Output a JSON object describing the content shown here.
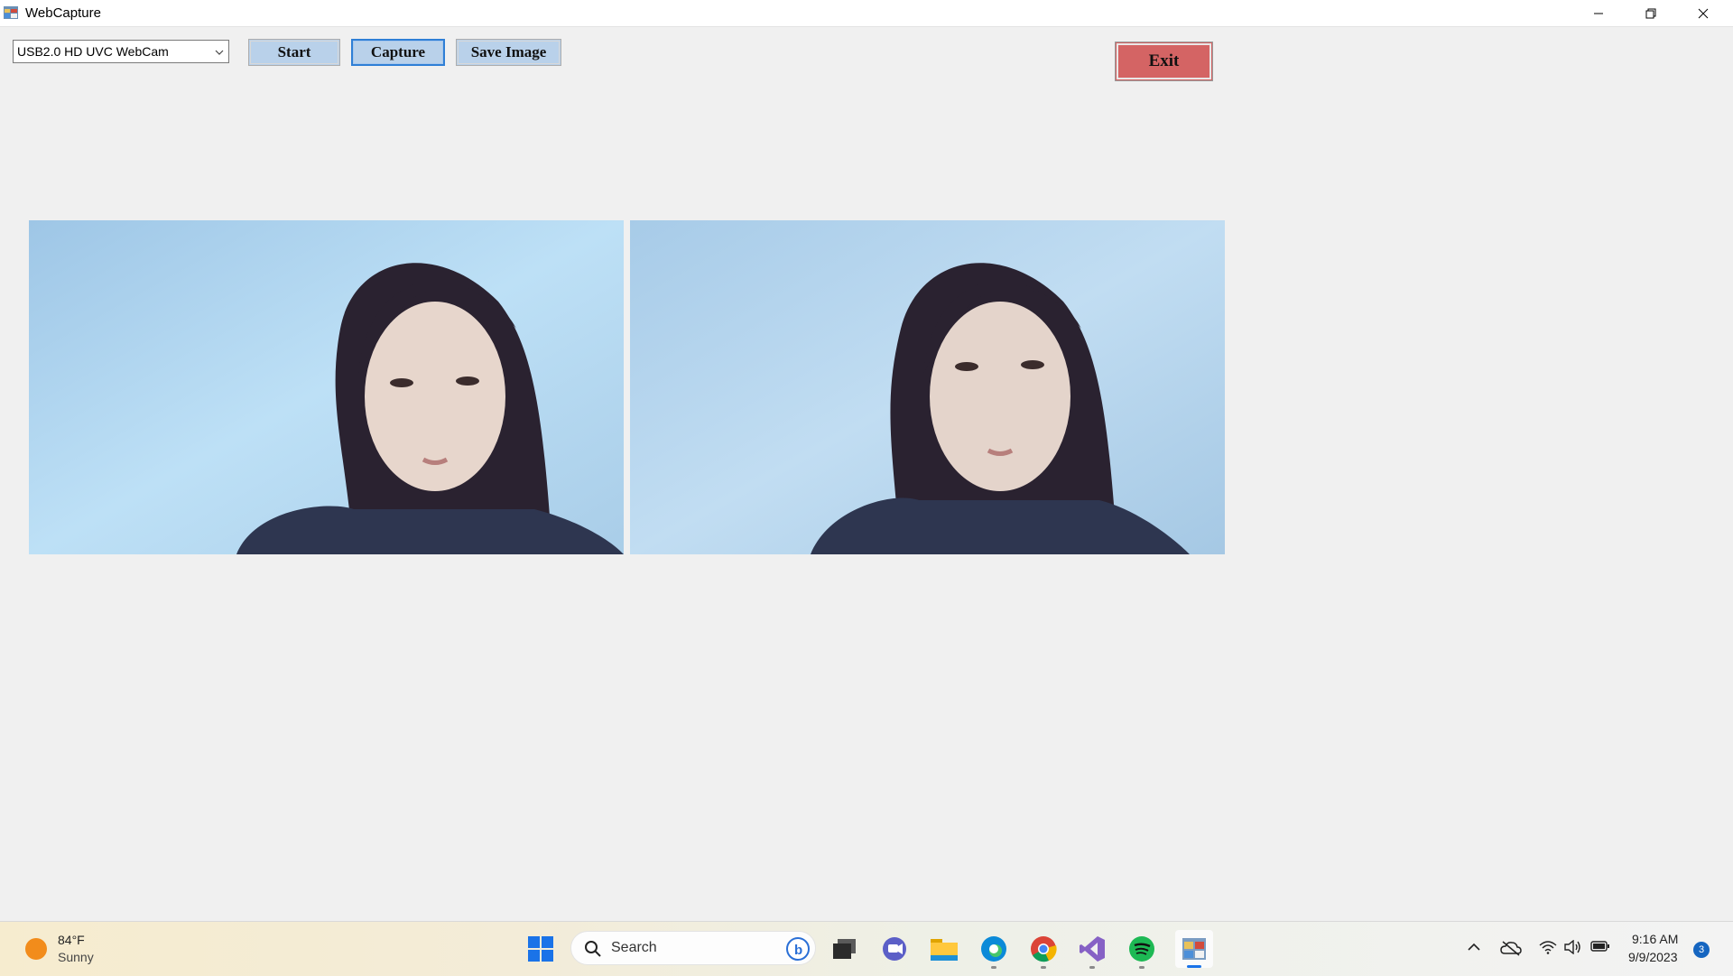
{
  "window": {
    "title": "WebCapture"
  },
  "toolbar": {
    "device_value": "USB2.0 HD UVC WebCam",
    "start_label": "Start",
    "capture_label": "Capture",
    "save_label": "Save Image",
    "exit_label": "Exit"
  },
  "pictures": {
    "live_icon": "webcam-live-image",
    "captured_icon": "captured-still-image"
  },
  "taskbar": {
    "weather_temp": "84°F",
    "weather_condition": "Sunny",
    "search_placeholder": "Search",
    "apps": [
      "start-icon",
      "search-icon",
      "bing-icon",
      "task-view-icon",
      "teams-icon",
      "file-explorer-icon",
      "edge-icon",
      "chrome-icon",
      "visual-studio-icon",
      "spotify-icon",
      "webcapture-app-icon"
    ],
    "tray": [
      "chevron-up-icon",
      "onedrive-icon",
      "wifi-icon",
      "volume-icon",
      "battery-icon"
    ],
    "time": "9:16 AM",
    "date": "9/9/2023",
    "notification_count": "3"
  },
  "colors": {
    "button_face": "#b9d1ea",
    "exit_button": "#d46464",
    "capture_focus": "#2f7fd6",
    "window_bg": "#f0f0f0"
  }
}
